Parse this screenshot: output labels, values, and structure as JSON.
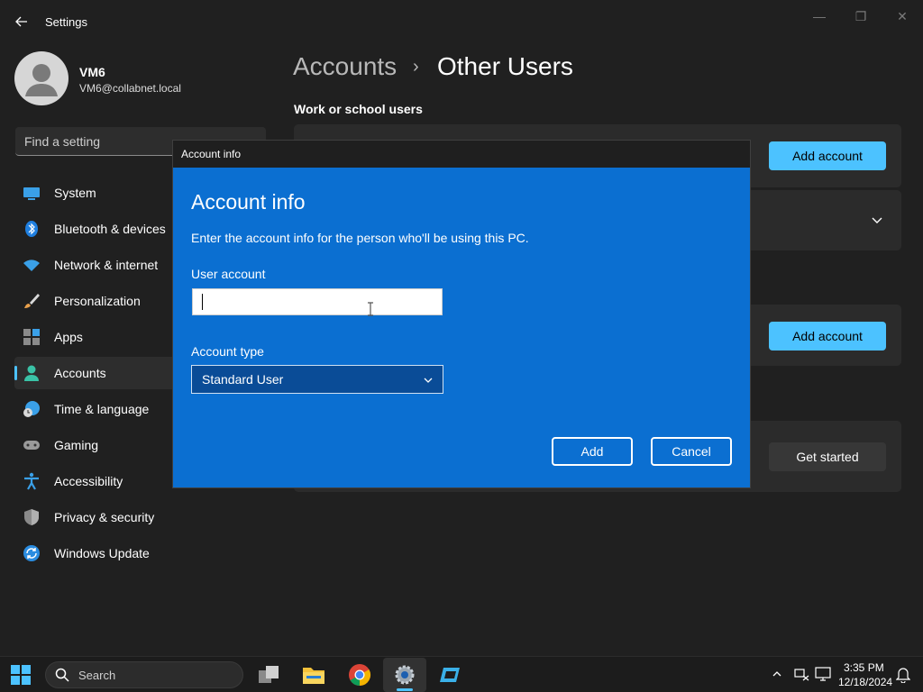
{
  "window": {
    "title": "Settings",
    "controls": [
      "—",
      "❐",
      "✕"
    ]
  },
  "profile": {
    "name": "VM6",
    "email": "VM6@collabnet.local"
  },
  "search": {
    "placeholder": "Find a setting"
  },
  "sidebar": {
    "items": [
      {
        "label": "System",
        "icon": "system-icon"
      },
      {
        "label": "Bluetooth & devices",
        "icon": "bluetooth-icon"
      },
      {
        "label": "Network & internet",
        "icon": "wifi-icon"
      },
      {
        "label": "Personalization",
        "icon": "brush-icon"
      },
      {
        "label": "Apps",
        "icon": "apps-icon"
      },
      {
        "label": "Accounts",
        "icon": "accounts-icon",
        "active": true
      },
      {
        "label": "Time & language",
        "icon": "clock-globe-icon"
      },
      {
        "label": "Gaming",
        "icon": "gamepad-icon"
      },
      {
        "label": "Accessibility",
        "icon": "accessibility-icon"
      },
      {
        "label": "Privacy & security",
        "icon": "shield-icon"
      },
      {
        "label": "Windows Update",
        "icon": "update-icon"
      }
    ],
    "accent": "#4cc2ff"
  },
  "breadcrumb": {
    "parent": "Accounts",
    "separator": "›",
    "current": "Other Users"
  },
  "main": {
    "section_title": "Work or school users",
    "add_account_1": "Add account",
    "add_account_2": "Add account",
    "get_started": "Get started"
  },
  "dialog": {
    "titlebar": "Account info",
    "heading": "Account info",
    "description": "Enter the account info for the person who'll be using this PC.",
    "user_account_label": "User account",
    "user_account_value": "",
    "account_type_label": "Account type",
    "account_type_value": "Standard User",
    "add_label": "Add",
    "cancel_label": "Cancel",
    "background": "#0b6fd1"
  },
  "taskbar": {
    "search_placeholder": "Search",
    "time": "3:35 PM",
    "date": "12/18/2024"
  }
}
